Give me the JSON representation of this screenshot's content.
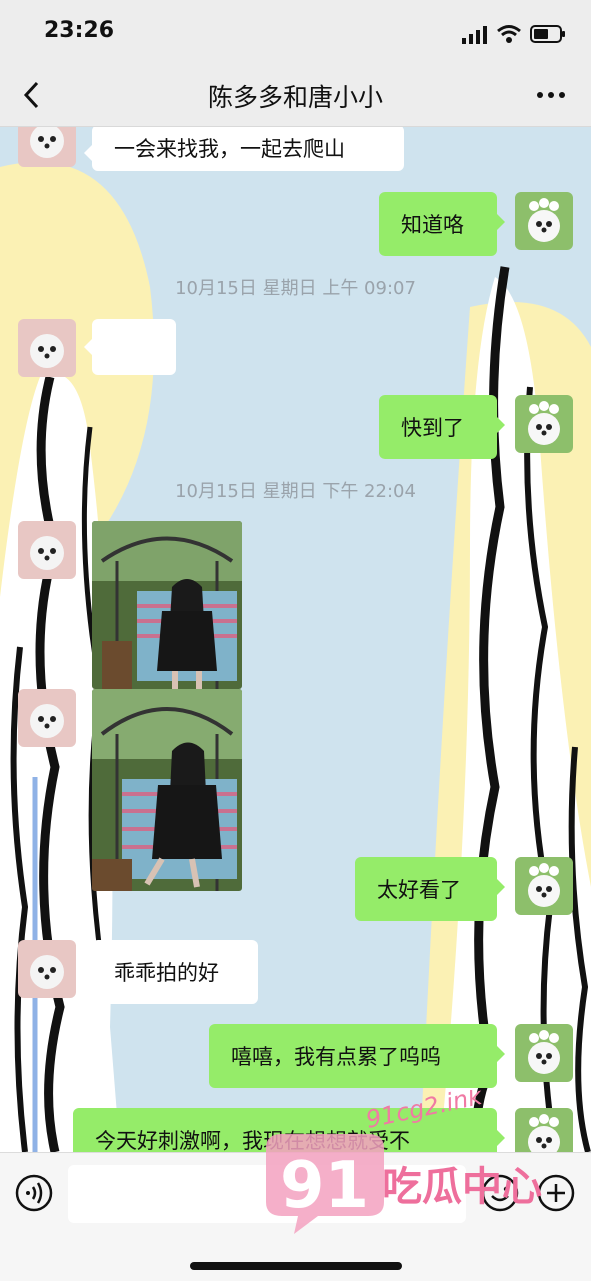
{
  "status_bar": {
    "time": "23:26"
  },
  "header": {
    "title": "陈多多和唐小小"
  },
  "colors": {
    "background": "#ededed",
    "chat_background": "#cfe3ee",
    "outgoing_bubble": "#95ec69",
    "incoming_bubble": "#ffffff",
    "timestamp_text": "#9aa3ab"
  },
  "messages": [
    {
      "side": "in",
      "text": "一会来找我，一起去爬山"
    },
    {
      "side": "out",
      "text": "知道咯"
    },
    {
      "type": "timestamp",
      "text": "10月15日 星期日 上午 09:07"
    },
    {
      "side": "in",
      "text": ""
    },
    {
      "side": "out",
      "text": "快到了"
    },
    {
      "type": "timestamp",
      "text": "10月15日 星期日 下午 22:04"
    },
    {
      "side": "in",
      "type": "image"
    },
    {
      "side": "in",
      "type": "image"
    },
    {
      "side": "out",
      "text": "太好看了"
    },
    {
      "side": "in",
      "text": "乖乖拍的好"
    },
    {
      "side": "out",
      "text": "嘻嘻，我有点累了呜呜"
    },
    {
      "side": "out",
      "text": "今天好刺激啊，我现在想想就受不"
    }
  ],
  "input": {
    "placeholder": ""
  },
  "watermark": {
    "number": "91",
    "site": "91cg2.ink",
    "name": "吃瓜中心"
  },
  "icons": [
    "back-icon",
    "more-icon",
    "voice-icon",
    "emoji-icon",
    "plus-icon",
    "signal-icon",
    "wifi-icon",
    "battery-icon"
  ]
}
